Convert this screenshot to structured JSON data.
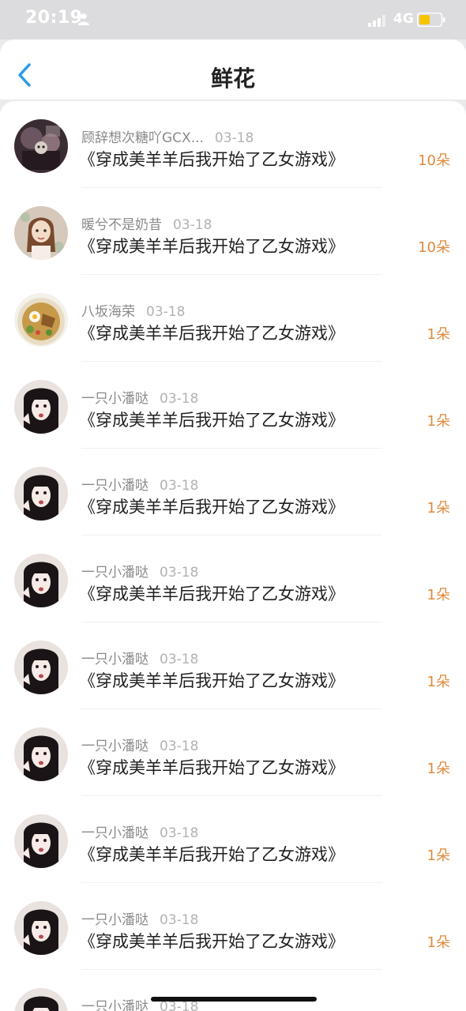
{
  "status_bar": {
    "time": "20:19",
    "network": "4G",
    "battery_color": "#f6c500"
  },
  "header": {
    "title": "鲜花"
  },
  "book_title": "《穿成美羊羊后我开始了乙女游戏》",
  "rows": [
    {
      "user": "顾辞想次糖吖GCX...",
      "date": "03-18",
      "count": "10朵",
      "avatar": "dark-collage"
    },
    {
      "user": "暖兮不是奶昔",
      "date": "03-18",
      "count": "10朵",
      "avatar": "illustrated-girl"
    },
    {
      "user": "八坂海荣",
      "date": "03-18",
      "count": "1朵",
      "avatar": "food-plate"
    },
    {
      "user": "一只小潘哒",
      "date": "03-18",
      "count": "1朵",
      "avatar": "anime-girl"
    },
    {
      "user": "一只小潘哒",
      "date": "03-18",
      "count": "1朵",
      "avatar": "anime-girl"
    },
    {
      "user": "一只小潘哒",
      "date": "03-18",
      "count": "1朵",
      "avatar": "anime-girl"
    },
    {
      "user": "一只小潘哒",
      "date": "03-18",
      "count": "1朵",
      "avatar": "anime-girl"
    },
    {
      "user": "一只小潘哒",
      "date": "03-18",
      "count": "1朵",
      "avatar": "anime-girl"
    },
    {
      "user": "一只小潘哒",
      "date": "03-18",
      "count": "1朵",
      "avatar": "anime-girl"
    },
    {
      "user": "一只小潘哒",
      "date": "03-18",
      "count": "1朵",
      "avatar": "anime-girl"
    },
    {
      "user": "一只小潘哒",
      "date": "03-18",
      "count": "",
      "avatar": "anime-girl"
    }
  ],
  "colors": {
    "accent_blue": "#2b9be8",
    "count_orange": "#e08a3c"
  }
}
